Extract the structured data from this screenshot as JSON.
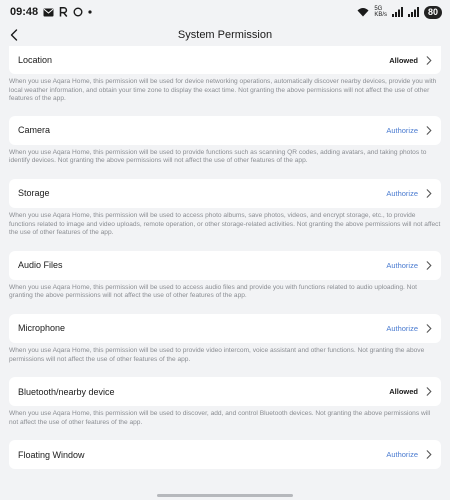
{
  "status_bar": {
    "time": "09:48",
    "battery": "80",
    "network": "5G",
    "network_speed": "KB/s"
  },
  "header": {
    "title": "System Permission"
  },
  "permissions": [
    {
      "name": "Location",
      "status": "Allowed",
      "status_type": "allowed",
      "description": "When you use Aqara Home, this permission will be used for device networking operations, automatically discover nearby devices, provide you with local weather information, and obtain your time zone to display the exact time. Not granting the above permissions will not affect the use of other features of the app."
    },
    {
      "name": "Camera",
      "status": "Authorize",
      "status_type": "authorize",
      "description": "When you use Aqara Home, this permission will be used to provide functions such as scanning QR codes, adding avatars, and taking photos to identify devices. Not granting the above permissions will not affect the use of other features of the app."
    },
    {
      "name": "Storage",
      "status": "Authorize",
      "status_type": "authorize",
      "description": "When you use Aqara Home, this permission will be used to access photo albums, save photos, videos, and encrypt storage, etc., to provide functions related to image and video uploads, remote operation, or other storage-related activities. Not granting the above permissions will not affect the use of other features of the app."
    },
    {
      "name": "Audio Files",
      "status": "Authorize",
      "status_type": "authorize",
      "description": "When you use Aqara Home, this permission will be used to access audio files and provide you with functions related to audio uploading. Not granting the above permissions will not affect the use of other features of the app."
    },
    {
      "name": "Microphone",
      "status": "Authorize",
      "status_type": "authorize",
      "description": "When you use Aqara Home, this permission will be used to provide video intercom, voice assistant and other functions. Not granting the above permissions will not affect the use of other features of the app."
    },
    {
      "name": "Bluetooth/nearby device",
      "status": "Allowed",
      "status_type": "allowed",
      "description": "When you use Aqara Home, this permission will be used to discover, add, and control Bluetooth devices. Not granting the above permissions will not affect the use of other features of the app."
    },
    {
      "name": "Floating Window",
      "status": "Authorize",
      "status_type": "authorize",
      "description": ""
    }
  ],
  "icons": {
    "back": "chevron-left-icon",
    "row_arrow": "chevron-right-icon",
    "mail": "mail-icon",
    "r_notification": "r-notification-icon",
    "circle_notification": "circle-notification-icon",
    "dot": "dot-icon",
    "wifi": "wifi-icon",
    "signal": "signal-icon"
  },
  "colors": {
    "background": "#f2f3f5",
    "card": "#ffffff",
    "authorize": "#4a7bd0",
    "description": "#8a8d92"
  }
}
